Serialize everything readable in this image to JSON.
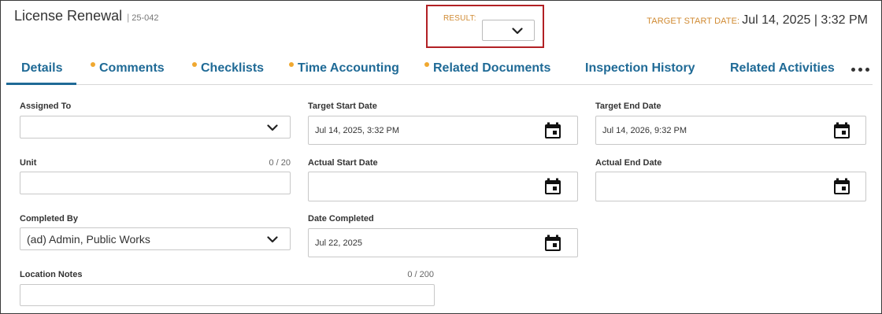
{
  "header": {
    "title": "License Renewal",
    "separator": "|",
    "record_code": "25-042",
    "result_label": "RESULT:",
    "target_start_label": "TARGET START DATE:",
    "target_start_value": "Jul 14, 2025 | 3:32 PM"
  },
  "tabs": [
    {
      "label": "Details",
      "active": true,
      "dot": false
    },
    {
      "label": "Comments",
      "active": false,
      "dot": true
    },
    {
      "label": "Checklists",
      "active": false,
      "dot": true
    },
    {
      "label": "Time Accounting",
      "active": false,
      "dot": true
    },
    {
      "label": "Related Documents",
      "active": false,
      "dot": true
    },
    {
      "label": "Inspection History",
      "active": false,
      "dot": false
    },
    {
      "label": "Related Activities",
      "active": false,
      "dot": false
    }
  ],
  "form": {
    "assigned_to": {
      "label": "Assigned To",
      "value": ""
    },
    "target_start_date": {
      "label": "Target Start Date",
      "value": "Jul 14, 2025, 3:32 PM"
    },
    "target_end_date": {
      "label": "Target End Date",
      "value": "Jul 14, 2026, 9:32 PM"
    },
    "unit": {
      "label": "Unit",
      "value": "",
      "counter": "0 / 20"
    },
    "actual_start_date": {
      "label": "Actual Start Date",
      "value": ""
    },
    "actual_end_date": {
      "label": "Actual End Date",
      "value": ""
    },
    "completed_by": {
      "label": "Completed By",
      "value": "(ad) Admin, Public Works"
    },
    "date_completed": {
      "label": "Date Completed",
      "value": "Jul 22, 2025"
    },
    "location_notes": {
      "label": "Location Notes",
      "value": "",
      "counter": "0 / 200"
    }
  },
  "colors": {
    "accent": "#1f6a96",
    "orange_label": "#d08a32",
    "tab_dot": "#f0a830",
    "highlight_border": "#b22024"
  },
  "icons": {
    "dropdown": "chevron-down-icon",
    "calendar": "calendar-icon",
    "more": "more-dots-icon"
  }
}
